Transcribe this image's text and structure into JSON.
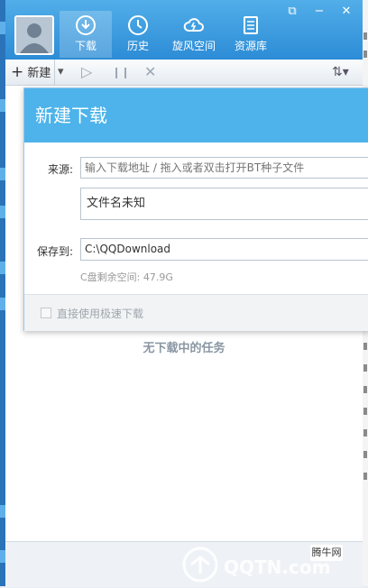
{
  "nav": {
    "items": [
      {
        "label": "下载",
        "icon": "download-icon"
      },
      {
        "label": "历史",
        "icon": "history-icon"
      },
      {
        "label": "旋风空间",
        "icon": "cloud-space-icon"
      },
      {
        "label": "资源库",
        "icon": "resource-library-icon"
      }
    ]
  },
  "window": {
    "restore_symbol": "⧉",
    "minimize_symbol": "−",
    "close_symbol": "✕"
  },
  "toolbar": {
    "new_label": "新建",
    "new_symbol": "+",
    "dropdown_symbol": "▾",
    "play_symbol": "▷",
    "pause_symbol": "❙❙",
    "delete_symbol": "✕",
    "sort_symbol": "⇅▾"
  },
  "list": {
    "empty_text": "无下载中的任务"
  },
  "dialog": {
    "title": "新建下载",
    "source_label": "来源:",
    "source_placeholder": "输入下载地址 / 拖入或者双击打开BT种子文件",
    "filename_value": "文件名未知",
    "save_label": "保存到:",
    "save_path": "C:\\QQDownload",
    "free_space": "C盘剩余空间: 47.9G",
    "fast_download_label": "直接使用极速下载"
  },
  "watermark": {
    "logo_text": "QQTN.com",
    "site_name": "腾牛网"
  },
  "colors": {
    "header": "#2c8cd6",
    "dialog_header": "#4db3ea"
  }
}
